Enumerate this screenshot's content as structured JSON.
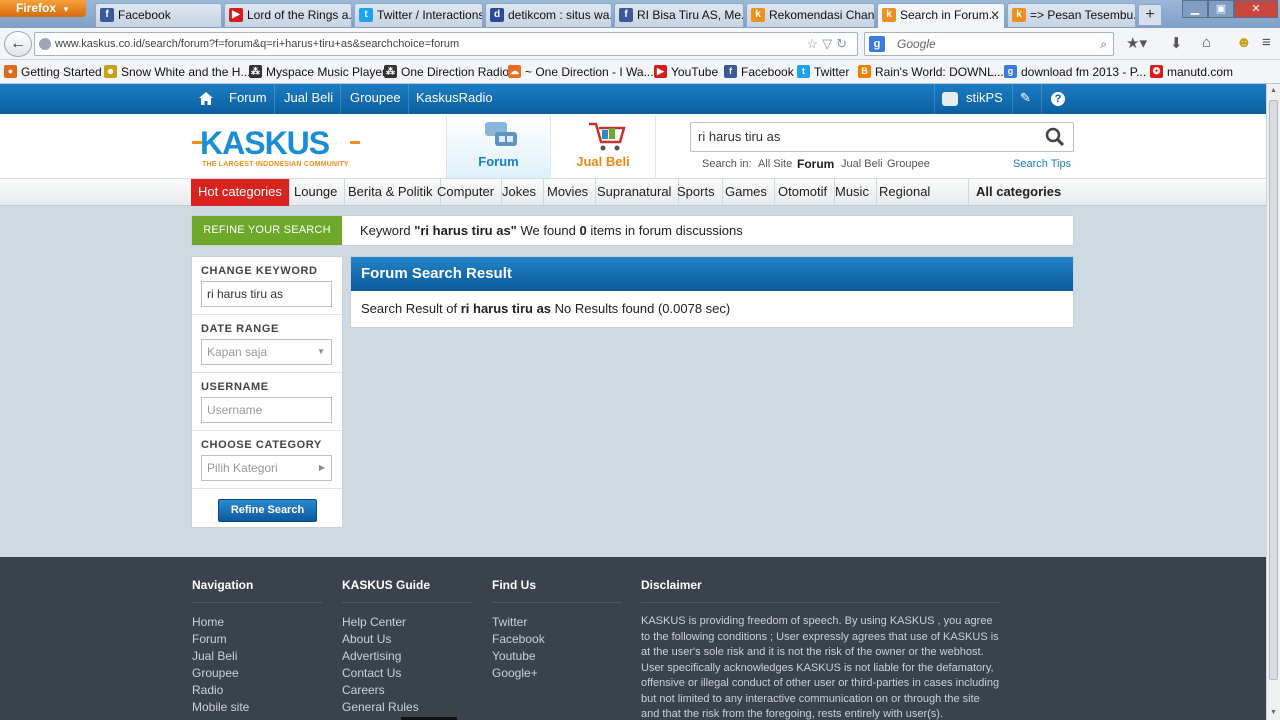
{
  "browser": {
    "app_button": "Firefox",
    "tabs": [
      {
        "label": "Facebook",
        "icon": "facebook-icon",
        "color": "#3b5998",
        "glyph": "f"
      },
      {
        "label": "Lord of the Rings a...",
        "icon": "youtube-icon",
        "color": "#d81b1b",
        "glyph": "▶"
      },
      {
        "label": "Twitter / Interactions",
        "icon": "twitter-icon",
        "color": "#1da1f2",
        "glyph": "t"
      },
      {
        "label": "detikcom : situs wa...",
        "icon": "detik-icon",
        "color": "#2b4a9a",
        "glyph": "d"
      },
      {
        "label": "RI Bisa Tiru AS, Me...",
        "icon": "facebook-icon",
        "color": "#3b5998",
        "glyph": "f"
      },
      {
        "label": "Rekomendasi Chan...",
        "icon": "kaskus-icon",
        "color": "#f18f1c",
        "glyph": "k"
      },
      {
        "label": "Search in Forum...",
        "icon": "kaskus-icon",
        "color": "#f18f1c",
        "glyph": "k"
      },
      {
        "label": "=> Pesan Tesembu...",
        "icon": "kaskus-icon",
        "color": "#f18f1c",
        "glyph": "k"
      }
    ],
    "url": "www.kaskus.co.id/search/forum?f=forum&q=ri+harus+tiru+as&searchchoice=forum",
    "search_placeholder": "Google",
    "bookmarks": [
      {
        "label": "Getting Started",
        "color": "#e06a1c",
        "glyph": "●"
      },
      {
        "label": "Snow White and the H...",
        "color": "#c8a020",
        "glyph": "☻"
      },
      {
        "label": "Myspace Music Player",
        "color": "#333333",
        "glyph": "⁂"
      },
      {
        "label": "One Direction Radio",
        "color": "#333333",
        "glyph": "⁂"
      },
      {
        "label": "~ One Direction - I Wa...",
        "color": "#f06a1c",
        "glyph": "☁"
      },
      {
        "label": "YouTube",
        "color": "#d81b1b",
        "glyph": "▶"
      },
      {
        "label": "Facebook",
        "color": "#3b5998",
        "glyph": "f"
      },
      {
        "label": "Twitter",
        "color": "#1da1f2",
        "glyph": "t"
      },
      {
        "label": "Rain's World: DOWNL...",
        "color": "#f57d00",
        "glyph": "B"
      },
      {
        "label": "download fm 2013 - P...",
        "color": "#3a7be0",
        "glyph": "g"
      },
      {
        "label": "manutd.com",
        "color": "#d81b1b",
        "glyph": "❂"
      }
    ]
  },
  "site": {
    "topnav": [
      "Forum",
      "Jual Beli",
      "Groupee",
      "KaskusRadio"
    ],
    "username": "stikPS",
    "logo_text": "KASKUS",
    "logo_sub": "THE LARGEST INDONESIAN COMMUNITY",
    "forum_tab": "Forum",
    "jualbeli_tab": "Jual Beli",
    "search_query": "ri harus tiru as",
    "search_in_label": "Search in:",
    "search_in_options": [
      "All Site",
      "Forum",
      "Jual Beli",
      "Groupee"
    ],
    "search_tips": "Search Tips",
    "categories": [
      "Hot categories",
      "Lounge",
      "Berita & Politik",
      "Computer",
      "Jokes",
      "Movies",
      "Supranatural",
      "Sports",
      "Games",
      "Otomotif",
      "Music",
      "Regional"
    ],
    "all_categories": "All categories"
  },
  "refine": {
    "tag": "REFINE YOUR SEARCH",
    "msg_prefix": "Keyword ",
    "msg_keyword": "\"ri harus tiru as\"",
    "msg_middle": " We found ",
    "msg_count": "0",
    "msg_suffix": " items in forum discussions"
  },
  "sidebar": {
    "change_keyword_label": "CHANGE KEYWORD",
    "keyword_value": "ri harus tiru as",
    "date_range_label": "DATE RANGE",
    "date_range_placeholder": "Kapan saja",
    "username_label": "USERNAME",
    "username_placeholder": "Username",
    "category_label": "CHOOSE CATEGORY",
    "category_placeholder": "Pilih Kategori",
    "refine_button": "Refine Search"
  },
  "result": {
    "title": "Forum Search Result",
    "prefix": "Search Result of ",
    "keyword": "ri harus tiru as",
    "suffix": " No Results found (0.0078 sec)"
  },
  "footer": {
    "navigation": {
      "title": "Navigation",
      "links": [
        "Home",
        "Forum",
        "Jual Beli",
        "Groupee",
        "Radio",
        "Mobile site"
      ]
    },
    "guide": {
      "title": "KASKUS Guide",
      "links": [
        "Help Center",
        "About Us",
        "Advertising",
        "Contact Us",
        "Careers",
        "General Rules"
      ]
    },
    "findus": {
      "title": "Find Us",
      "links": [
        "Twitter",
        "Facebook",
        "Youtube",
        "Google+"
      ]
    },
    "disclaimer": {
      "title": "Disclaimer",
      "text": "KASKUS is providing freedom of speech. By using KASKUS , you agree to the following conditions ; User expressly agrees that use of KASKUS is at the user's sole risk and it is not the risk of the owner or the webhost. User specifically acknowledges KASKUS is not liable for the defamatory, offensive or illegal conduct of other user or third-parties in cases including but not limited to any interactive communication on or through the site and that the risk from the foregoing, rests entirely with user(s)."
    }
  }
}
